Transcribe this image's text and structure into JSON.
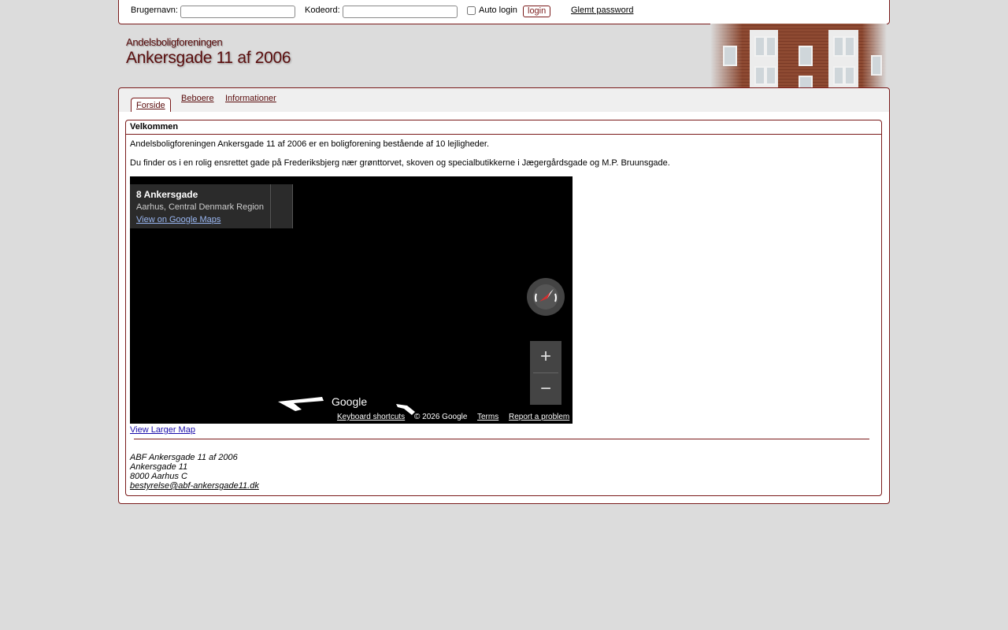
{
  "login": {
    "username_label": "Brugernavn:",
    "username_value": "",
    "password_label": "Kodeord:",
    "password_value": "",
    "autologin_label": "Auto login",
    "autologin_checked": false,
    "login_button": "login",
    "forgot_password": "Glemt password"
  },
  "header": {
    "association": "Andelsboligforeningen",
    "title": "Ankersgade 11 af 2006"
  },
  "nav": {
    "tabs": [
      {
        "label": "Forside",
        "active": true
      },
      {
        "label": "Beboere",
        "active": false
      },
      {
        "label": "Informationer",
        "active": false
      }
    ]
  },
  "content": {
    "box_title": "Velkommen",
    "paragraph1": "Andelsboligforeningen Ankersgade 11 af 2006 er en boligforening bestående af 10 lejligheder.",
    "paragraph2": "Du finder os i en rolig ensrettet gade på Frederiksbjerg nær grønttorvet, skoven og specialbutikkerne i Jægergårdsgade og M.P. Bruunsgade.",
    "map": {
      "place_name": "8 Ankersgade",
      "place_region": "Aarhus, Central Denmark Region",
      "view_on_google_maps": "View on Google Maps",
      "google_logo": "Google",
      "keyboard_shortcuts": "Keyboard shortcuts",
      "copyright": "© 2026 Google",
      "terms": "Terms",
      "report_problem": "Report a problem",
      "zoom_in": "+",
      "zoom_out": "−"
    },
    "view_larger_map": "View Larger Map",
    "address": {
      "line1": "ABF Ankersgade 11 af 2006",
      "line2": "Ankersgade 11",
      "line3": "8000 Aarhus C",
      "email": "bestyrelse@abf-ankersgade11.dk"
    }
  }
}
